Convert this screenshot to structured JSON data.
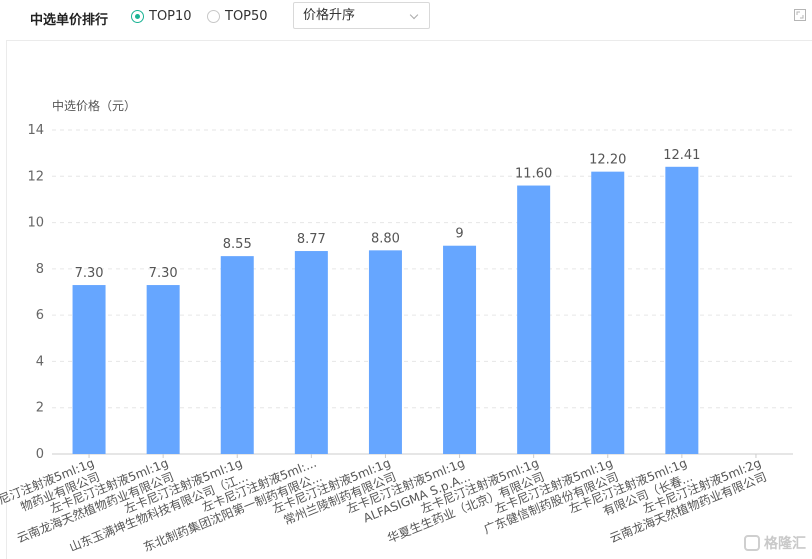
{
  "header": {
    "title": "中选单价排行",
    "radios": [
      {
        "label": "TOP10",
        "checked": true
      },
      {
        "label": "TOP50",
        "checked": false
      }
    ],
    "sort_select": "价格升序"
  },
  "watermark": "格隆汇",
  "colors": {
    "bar": "#66a6ff",
    "accent": "#1ab394"
  },
  "chart_data": {
    "type": "bar",
    "ylabel": "中选价格（元）",
    "ylim": [
      0,
      14
    ],
    "yticks": [
      0,
      2,
      4,
      6,
      8,
      10,
      12,
      14
    ],
    "categories": [
      "左卡尼汀注射液5ml:1g 物药业有限公司",
      "左卡尼汀注射液5ml:1g 云南龙海天然植物药业有限公司",
      "左卡尼汀注射液5ml:1g 山东玉满坤生物科技有限公司（江...",
      "左卡尼汀注射液5ml:... 东北制药集团沈阳第一制药有限公...",
      "左卡尼汀注射液5ml:1g 常州兰陵制药有限公司",
      "左卡尼汀注射液5ml:1g ALFASIGMA S.p.A...",
      "左卡尼汀注射液5ml:1g 华夏生生药业（北京）有限公司",
      "左卡尼汀注射液5ml:1g 广东健信制药股份有限公司",
      "左卡尼汀注射液5ml:1g 有限公司（长春...",
      "左卡尼汀注射液5ml:2g 云南龙海天然植物药业有限公司"
    ],
    "labels_line1": [
      "左卡尼汀注射液5ml:1g",
      "左卡尼汀注射液5ml:1g",
      "左卡尼汀注射液5ml:1g",
      "左卡尼汀注射液5ml:...",
      "左卡尼汀注射液5ml:1g",
      "左卡尼汀注射液5ml:1g",
      "左卡尼汀注射液5ml:1g",
      "左卡尼汀注射液5ml:1g",
      "左卡尼汀注射液5ml:1g",
      "左卡尼汀注射液5ml:2g"
    ],
    "labels_line2": [
      "物药业有限公司",
      "云南龙海天然植物药业有限公司",
      "山东玉满坤生物科技有限公司（江...",
      "东北制药集团沈阳第一制药有限公...",
      "常州兰陵制药有限公司",
      "ALFASIGMA S.p.A...",
      "华夏生生药业（北京）有限公司",
      "广东健信制药股份有限公司",
      "有限公司（长春...",
      "云南龙海天然植物药业有限公司"
    ],
    "values": [
      7.3,
      7.3,
      8.55,
      8.77,
      8.8,
      9,
      11.6,
      12.2,
      12.41,
      null
    ],
    "value_labels": [
      "7.30",
      "7.30",
      "8.55",
      "8.77",
      "8.80",
      "9",
      "11.60",
      "12.20",
      "12.41",
      ""
    ],
    "grid": true,
    "legend": "none"
  }
}
